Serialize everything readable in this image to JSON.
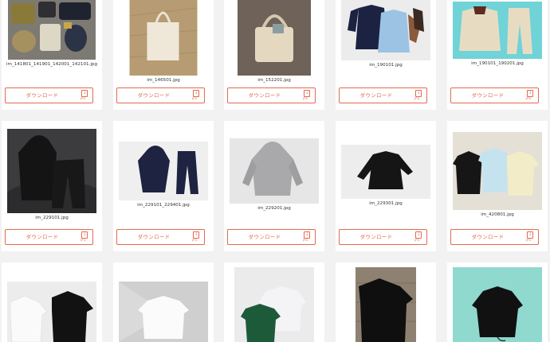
{
  "download_label": "ダウンロード",
  "file_type_label": "JPG",
  "accent_color": "#e36a50",
  "rows": [
    [
      {
        "file": "im_141801_141901_142001_142101.jpg",
        "subject": "bags"
      },
      {
        "file": "im_146501.jpg",
        "subject": "tote-bag"
      },
      {
        "file": "im_152201.jpg",
        "subject": "shoulder-bag"
      },
      {
        "file": "im_190101.jpg",
        "subject": "track-jackets"
      },
      {
        "file": "im_190101_190201.jpg",
        "subject": "jacket-pants"
      }
    ],
    [
      {
        "file": "im_229101.jpg",
        "subject": "black-hoodie-set"
      },
      {
        "file": "im_229101_229401.jpg",
        "subject": "navy-hoodie-set"
      },
      {
        "file": "im_229201.jpg",
        "subject": "grey-hoodie"
      },
      {
        "file": "im_229301.jpg",
        "subject": "black-jacket"
      },
      {
        "file": "im_420801.jpg",
        "subject": "tshirts"
      }
    ],
    [
      {
        "file": "",
        "subject": "white-black-tees"
      },
      {
        "file": "",
        "subject": "white-shirt"
      },
      {
        "file": "",
        "subject": "tshirt-stack"
      },
      {
        "file": "",
        "subject": "black-tee-wood"
      },
      {
        "file": "",
        "subject": "black-jacket-mint"
      }
    ]
  ]
}
